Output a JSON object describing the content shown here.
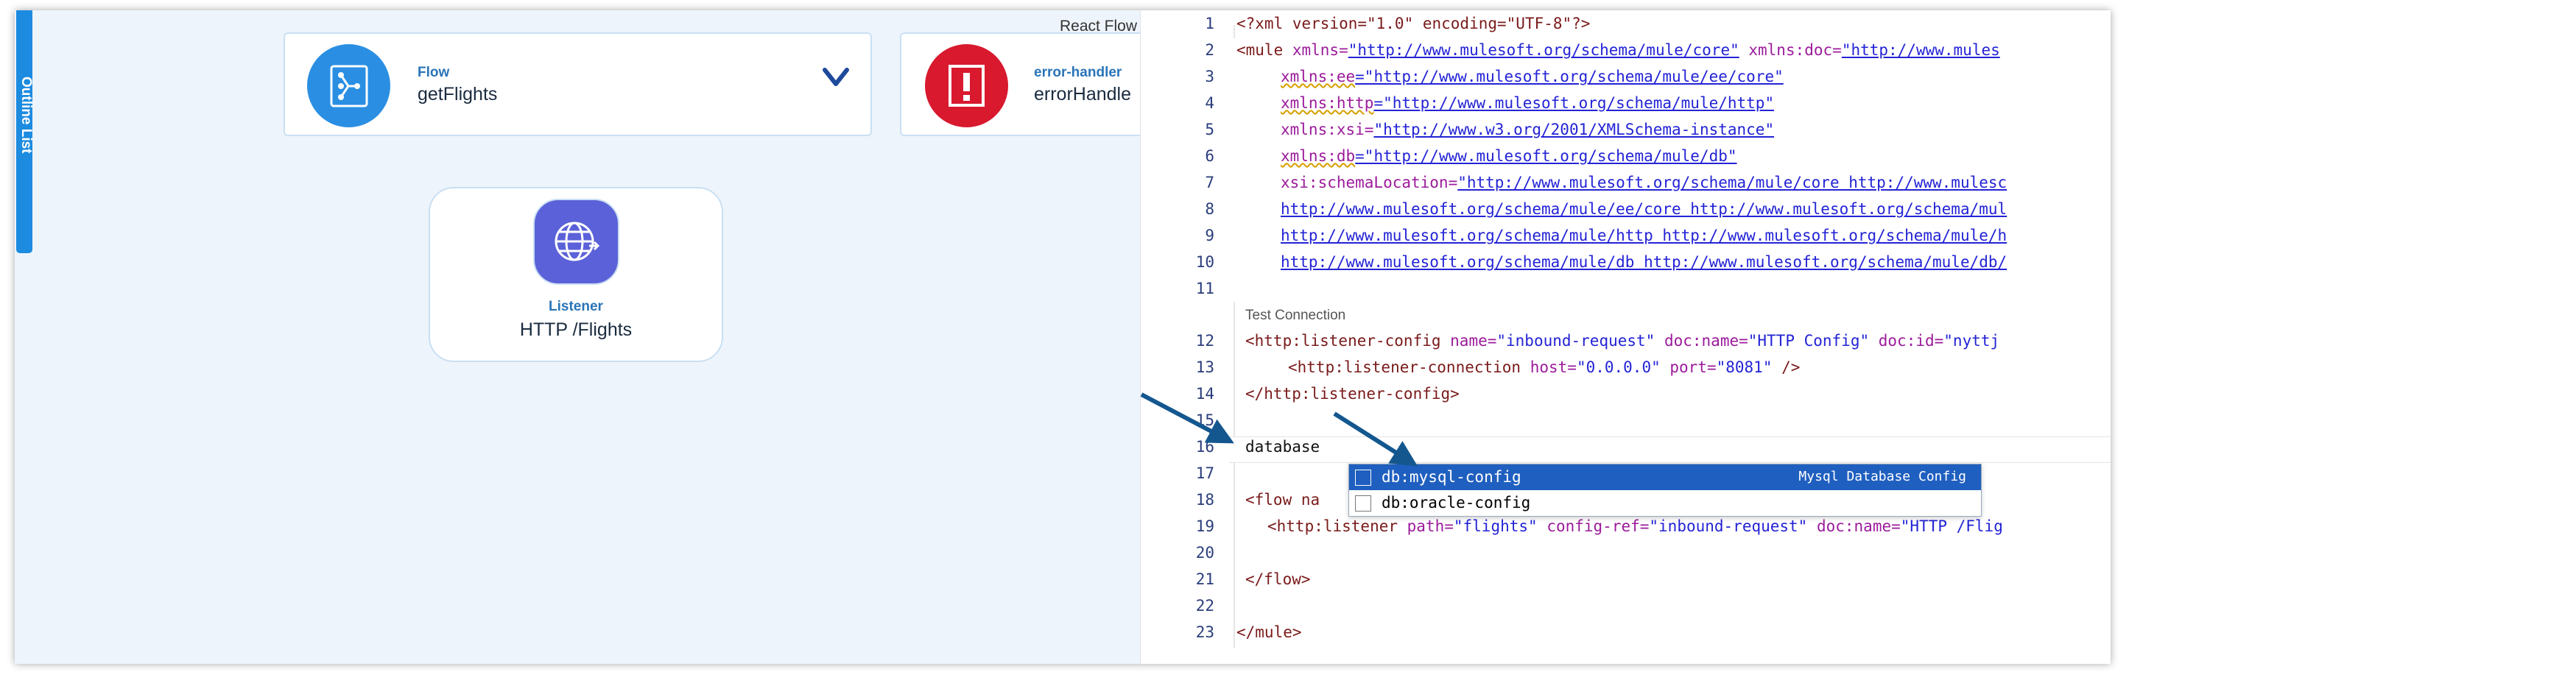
{
  "outline_tab": "Outline List",
  "react_flow_label": "React Flow",
  "flow_card": {
    "kind": "Flow",
    "name": "getFlights",
    "icon": "flow-icon"
  },
  "error_card": {
    "kind": "error-handler",
    "name": "errorHandle",
    "icon": "error-icon"
  },
  "listener_card": {
    "kind": "Listener",
    "name": "HTTP /Flights",
    "icon": "globe-icon"
  },
  "code_lens": "Test Connection",
  "line_numbers": [
    "1",
    "2",
    "3",
    "4",
    "5",
    "6",
    "7",
    "8",
    "9",
    "10",
    "11",
    "12",
    "13",
    "14",
    "15",
    "16",
    "17",
    "18",
    "19",
    "20",
    "21",
    "22",
    "23"
  ],
  "code": {
    "l1": "<?xml version=\"1.0\" encoding=\"UTF-8\"?>",
    "l2a": "<mule ",
    "l2b": "xmlns=",
    "l2c": "\"http://www.mulesoft.org/schema/mule/core\"",
    "l2d": " xmlns:doc=",
    "l2e": "\"http://www.mules",
    "l3a": "xmlns:ee",
    "l3b": "=\"http://www.mulesoft.org/schema/mule/ee/core\"",
    "l4a": "xmlns:http",
    "l4b": "=\"http://www.mulesoft.org/schema/mule/http\"",
    "l5a": "xmlns:xsi=",
    "l5b": "\"http://www.w3.org/2001/XMLSchema-instance\"",
    "l6a": "xmlns:db",
    "l6b": "=\"http://www.mulesoft.org/schema/mule/db\"",
    "l7a": "xsi:schemaLocation=",
    "l7b": "\"http://www.mulesoft.org/schema/mule/core http://www.mulesc",
    "l8": "http://www.mulesoft.org/schema/mule/ee/core http://www.mulesoft.org/schema/mul",
    "l9": "http://www.mulesoft.org/schema/mule/http http://www.mulesoft.org/schema/mule/h",
    "l10": "http://www.mulesoft.org/schema/mule/db http://www.mulesoft.org/schema/mule/db/",
    "l12a": "<http:listener-config ",
    "l12b": "name=",
    "l12c": "\"inbound-request\"",
    "l12d": " doc:name=",
    "l12e": "\"HTTP Config\"",
    "l12f": " doc:id=",
    "l12g": "\"nyttj",
    "l13a": "<http:listener-connection ",
    "l13b": "host=",
    "l13c": "\"0.0.0.0\"",
    "l13d": " port=",
    "l13e": "\"8081\"",
    "l13f": " />",
    "l14": "</http:listener-config>",
    "l16": "database",
    "l18a": "<flow na",
    "l19a": "<http:listener ",
    "l19b": "path=",
    "l19c": "\"flights\"",
    "l19d": " config-ref=",
    "l19e": "\"inbound-request\"",
    "l19f": " doc:name=",
    "l19g": "\"HTTP /Flig",
    "l21": "</flow>",
    "l23": "</mule>"
  },
  "autocomplete": {
    "items": [
      {
        "label": "db:mysql-config",
        "detail": "Mysql Database Config",
        "selected": true
      },
      {
        "label": "db:oracle-config",
        "detail": "",
        "selected": false
      }
    ]
  },
  "colors": {
    "accent": "#1c8be0",
    "error": "#d8192e",
    "listener": "#5b61d8",
    "selection": "#1f5fbf",
    "arrow": "#14578f"
  }
}
